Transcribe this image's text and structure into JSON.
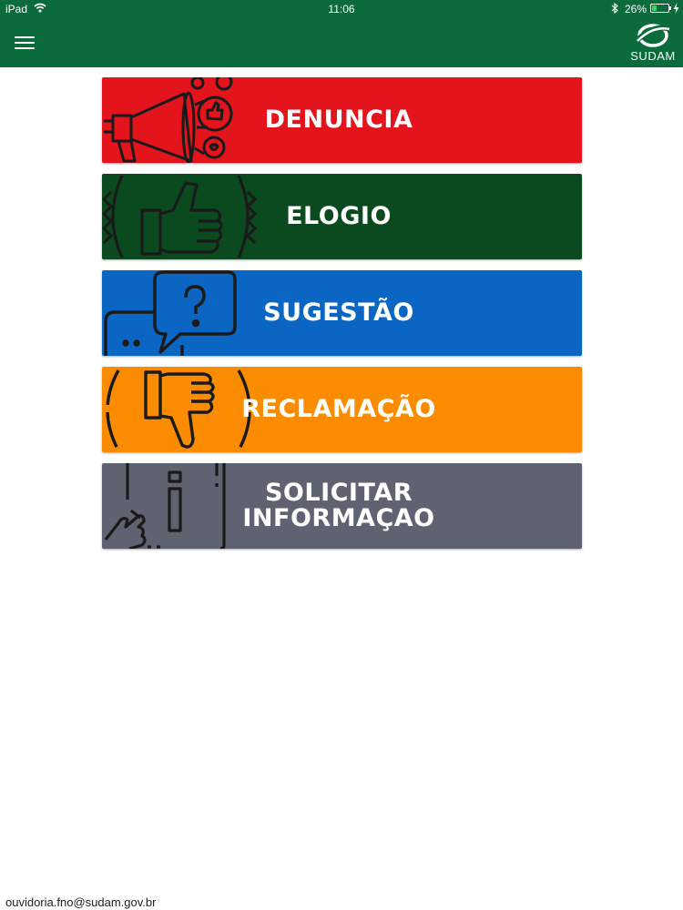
{
  "status_bar": {
    "device": "iPad",
    "time": "11:06",
    "battery_percent": "26%",
    "battery_level": 0.26
  },
  "header": {
    "logo_text": "SUDAM"
  },
  "colors": {
    "header": "#0b6b3a",
    "denuncia": "#e3141c",
    "elogio": "#0a4a1e",
    "sugestao": "#0a66c2",
    "reclamacao": "#fb8c00",
    "solicitar": "#5f6270"
  },
  "menu": {
    "items": [
      {
        "label": "DENUNCIA",
        "icon": "megaphone-icon"
      },
      {
        "label": "ELOGIO",
        "icon": "thumbs-up-icon"
      },
      {
        "label": "SUGESTÃO",
        "icon": "speech-bubble-question-icon"
      },
      {
        "label": "RECLAMAÇÃO",
        "icon": "thumbs-down-icon"
      },
      {
        "label": "SOLICITAR\nINFORMAÇAO",
        "icon": "info-touch-icon"
      }
    ]
  },
  "footer": {
    "email": "ouvidoria.fno@sudam.gov.br"
  }
}
